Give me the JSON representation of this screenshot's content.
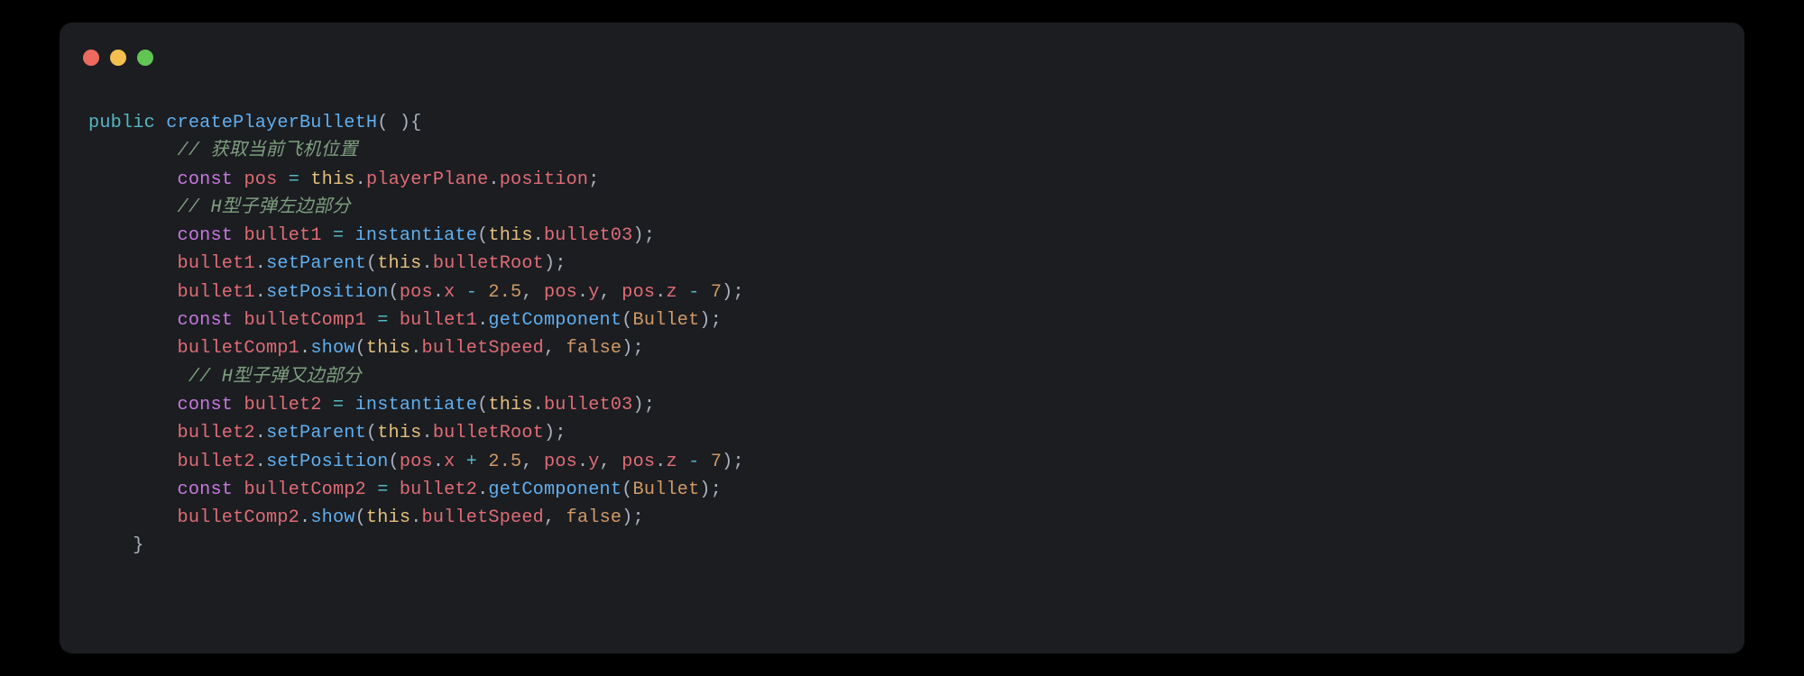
{
  "syntax": {
    "public": "public",
    "const": "const",
    "this": "this",
    "false": "false",
    "eq": " = ",
    "minus": " - ",
    "plus": " + ",
    "neg": "- ",
    "dot": ".",
    "comma": ", ",
    "lparen": "(",
    "rparen": ")",
    "lbrace": "{",
    "rbrace": "}",
    "semi": ";",
    "empty_parens": "( )"
  },
  "code": {
    "fn_name": "createPlayerBulletH",
    "comment_get_pos": "// 获取当前飞机位置",
    "comment_left": "// H型子弹左边部分",
    "comment_right": " // H型子弹又边部分",
    "pos": "pos",
    "playerPlane": "playerPlane",
    "position": "position",
    "bullet1": "bullet1",
    "bullet2": "bullet2",
    "bulletComp1": "bulletComp1",
    "bulletComp2": "bulletComp2",
    "instantiate": "instantiate",
    "bullet03": "bullet03",
    "setParent": "setParent",
    "bulletRoot": "bulletRoot",
    "setPosition": "setPosition",
    "x": "x",
    "y": "y",
    "z": "z",
    "getComponent": "getComponent",
    "Bullet": "Bullet",
    "show": "show",
    "bulletSpeed": "bulletSpeed",
    "num_2_5": "2.5",
    "num_7": "7"
  },
  "indent": {
    "i1": "    ",
    "i2": "        "
  },
  "colors": {
    "bg": "#000000",
    "panel": "#1b1d21",
    "red_dot": "#ed6a5e",
    "yellow_dot": "#f4bf4f",
    "green_dot": "#61c554"
  }
}
